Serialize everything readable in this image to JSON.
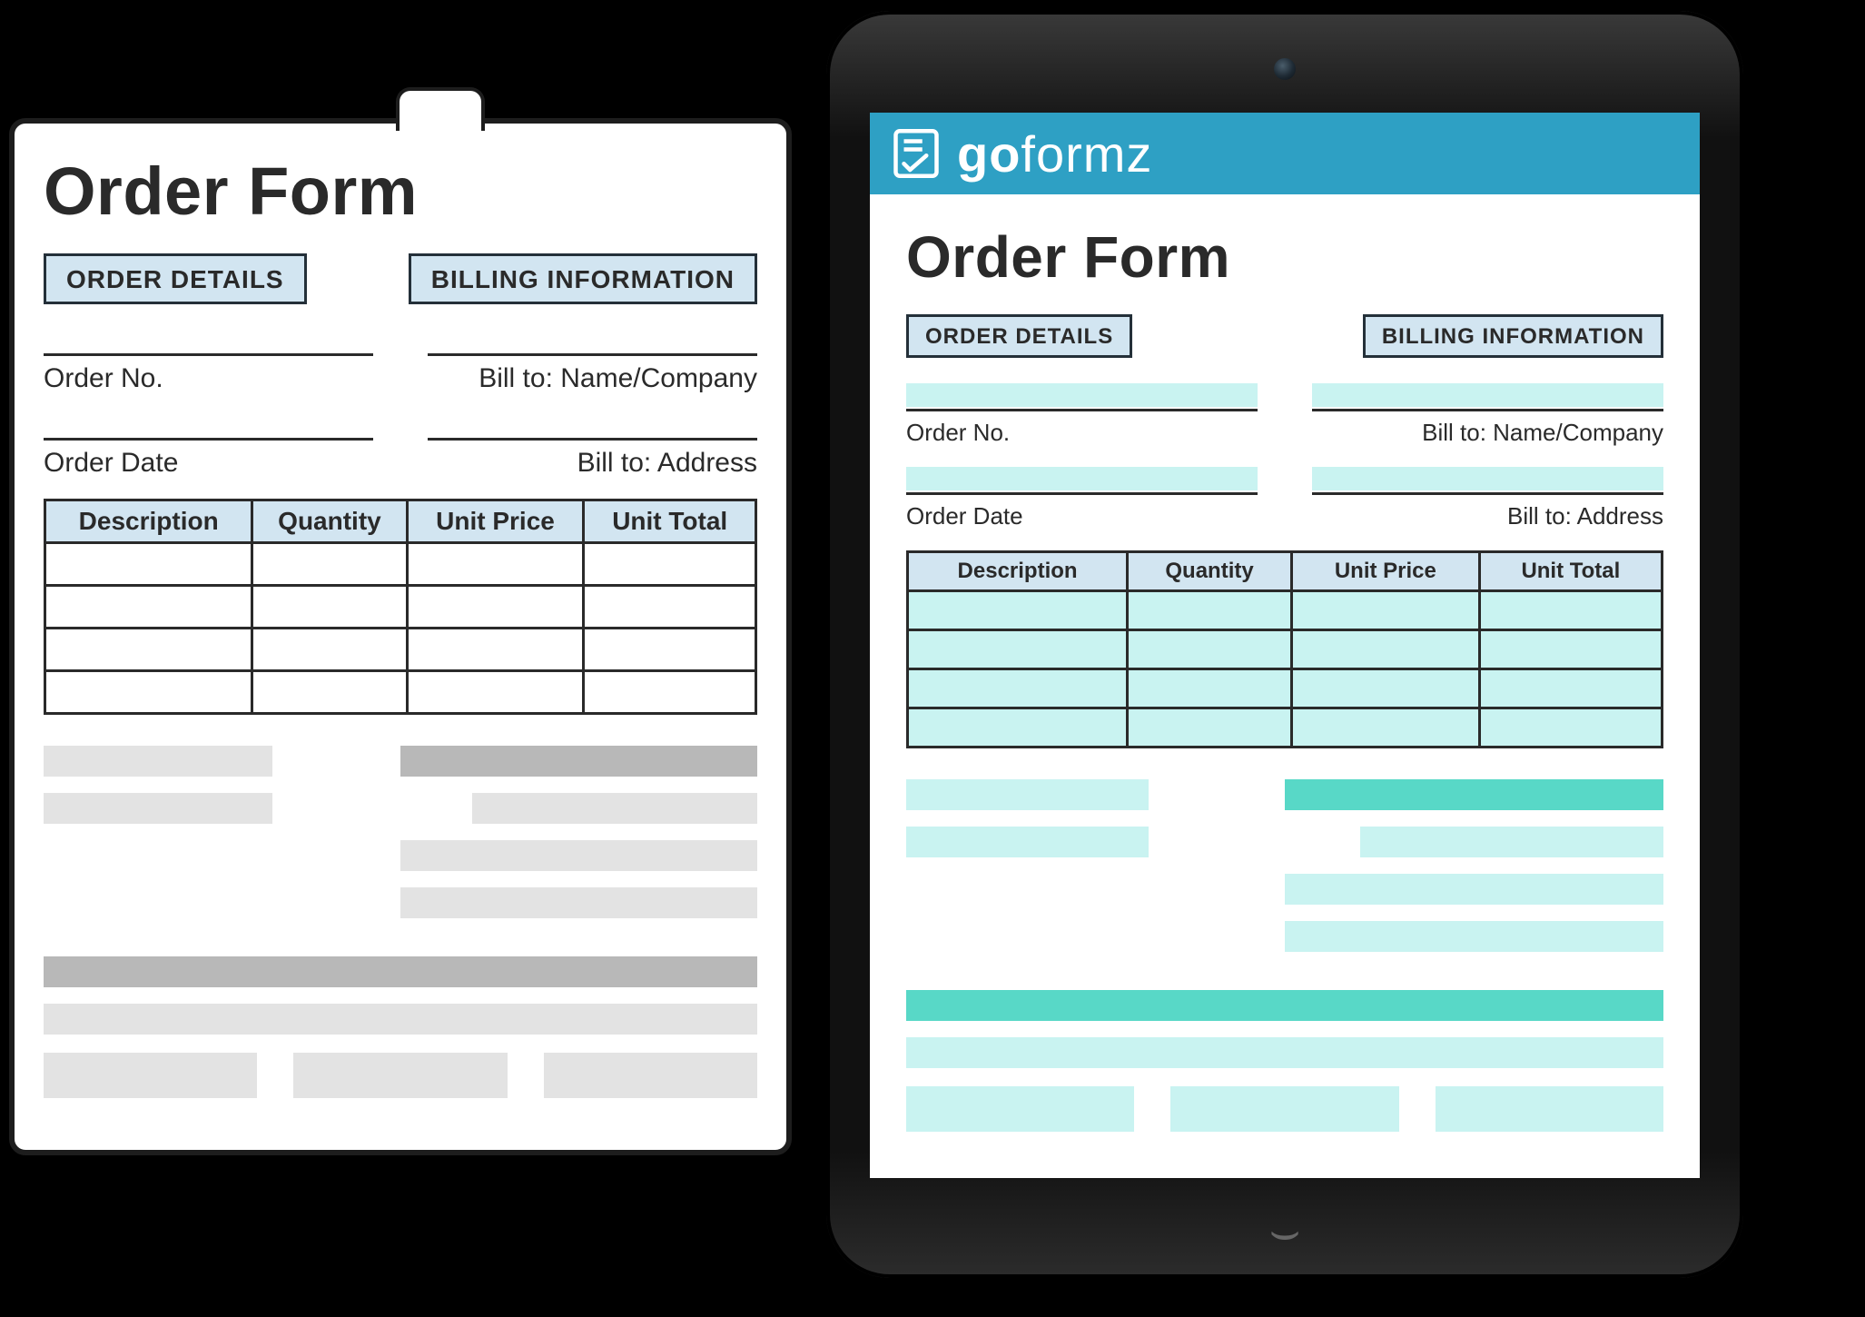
{
  "brand": {
    "go": "go",
    "formz": "formz"
  },
  "form": {
    "title": "Order Form",
    "order_details_tag": "ORDER DETAILS",
    "billing_info_tag": "BILLING INFORMATION",
    "order_no_label": "Order No.",
    "order_date_label": "Order Date",
    "bill_to_name_label": "Bill to: Name/Company",
    "bill_to_address_label": "Bill to: Address",
    "columns": {
      "description": "Description",
      "quantity": "Quantity",
      "unit_price": "Unit Price",
      "unit_total": "Unit Total"
    }
  },
  "colors": {
    "brand_bar": "#2ea0c4",
    "tag_fill": "#d2e5f1",
    "digital_highlight_light": "#c9f3f1",
    "digital_highlight_mid": "#58d8c7",
    "paper_block_light": "#e3e3e3",
    "paper_block_mid": "#b8b8b8"
  }
}
